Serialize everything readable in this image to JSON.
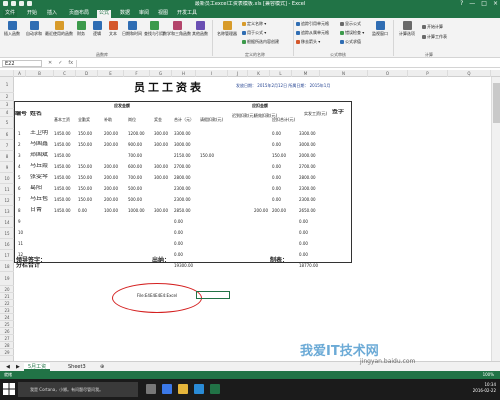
{
  "window": {
    "title": "最新员工excel工资表模板.xls [兼容模式] - Excel",
    "controls": [
      "?",
      "—",
      "□",
      "×"
    ]
  },
  "ribbon": {
    "tabs": [
      "文件",
      "开始",
      "插入",
      "页面布局",
      "公式",
      "数据",
      "审阅",
      "视图",
      "开发工具"
    ],
    "active_tab": "公式",
    "buttons": [
      {
        "label": "插入函数",
        "color": "#2f6db3"
      },
      {
        "label": "自动求和",
        "color": "#2f6db3"
      },
      {
        "label": "最近使用的函数",
        "color": "#d89b2a"
      },
      {
        "label": "财务",
        "color": "#3c9a4b"
      },
      {
        "label": "逻辑",
        "color": "#2f6db3"
      },
      {
        "label": "文本",
        "color": "#d4572b"
      },
      {
        "label": "日期和时间",
        "color": "#2f6db3"
      },
      {
        "label": "查找与引用",
        "color": "#3c9a4b"
      },
      {
        "label": "数学和三角函数",
        "color": "#b3456b"
      },
      {
        "label": "其他函数",
        "color": "#6a4fb3"
      },
      {
        "label": "名称管理器",
        "color": "#d89b2a"
      }
    ],
    "small_buttons": [
      "定义名称 ▾",
      "用于公式 ▾",
      "根据所选内容创建",
      "追踪引用单元格",
      "追踪从属单元格",
      "移去箭头 ▾",
      "显示公式",
      "错误检查 ▾",
      "公式求值",
      "监视窗口",
      "计算选项",
      "开始计算",
      "计算工作表"
    ],
    "groups": [
      "函数库",
      "定义的名称",
      "公式审核",
      "计算"
    ]
  },
  "formula_bar": {
    "name_box": "E22",
    "fx": "fx",
    "value": ""
  },
  "columns": [
    "A",
    "B",
    "C",
    "D",
    "E",
    "F",
    "G",
    "H",
    "I",
    "J",
    "K",
    "L",
    "M",
    "N",
    "O",
    "P",
    "Q"
  ],
  "rows": [
    "1",
    "2",
    "3",
    "4",
    "5",
    "6",
    "7",
    "8",
    "9",
    "10",
    "11",
    "12",
    "13",
    "14",
    "15",
    "16",
    "17",
    "18",
    "19",
    "20",
    "21",
    "22",
    "23",
    "24",
    "25",
    "26",
    "27",
    "28",
    "29"
  ],
  "sheet": {
    "title": "员工工资表",
    "date_label": "发放日期：  2015年2月12日  所属日期：  2015年1月",
    "headers": {
      "num": "编号",
      "name": "姓名",
      "payable": "应发金额",
      "deduct": "应扣金额",
      "net": "实发工资(元)",
      "sign": "签字",
      "sub": [
        "基本工资",
        "全勤奖",
        "补助",
        "岗位",
        "奖金",
        "合计（元）",
        "请假扣款(元)",
        "迟到扣款(元)",
        "绩效扣款(元)",
        "应扣合计(元)"
      ]
    },
    "rows": [
      {
        "no": "1",
        "name": "王卫明",
        "cells": [
          "1450.00",
          "150.00",
          "200.00",
          "1200.00",
          "300.00",
          "3300.00",
          "",
          "",
          "",
          "0.00",
          "3300.00"
        ]
      },
      {
        "no": "2",
        "name": "马国鑫",
        "cells": [
          "1450.00",
          "150.00",
          "200.00",
          "900.00",
          "300.00",
          "3000.00",
          "",
          "",
          "",
          "0.00",
          "3000.00"
        ]
      },
      {
        "no": "3",
        "name": "郑国斌",
        "cells": [
          "1450.00",
          "",
          "",
          "700.00",
          "",
          "2150.00",
          "150.00",
          "",
          "",
          "150.00",
          "2000.00"
        ]
      },
      {
        "no": "4",
        "name": "马丘霞",
        "cells": [
          "1450.00",
          "150.00",
          "200.00",
          "600.00",
          "300.00",
          "2700.00",
          "",
          "",
          "",
          "0.00",
          "2700.00"
        ]
      },
      {
        "no": "5",
        "name": "张雯琴",
        "cells": [
          "1450.00",
          "150.00",
          "200.00",
          "700.00",
          "300.00",
          "2800.00",
          "",
          "",
          "",
          "0.00",
          "2800.00"
        ]
      },
      {
        "no": "6",
        "name": "葛阳",
        "cells": [
          "1450.00",
          "150.00",
          "200.00",
          "500.00",
          "",
          "2300.00",
          "",
          "",
          "",
          "0.00",
          "2300.00"
        ]
      },
      {
        "no": "7",
        "name": "马丘苞",
        "cells": [
          "1450.00",
          "150.00",
          "200.00",
          "500.00",
          "",
          "2300.00",
          "",
          "",
          "",
          "0.00",
          "2300.00"
        ]
      },
      {
        "no": "8",
        "name": "甘菁",
        "cells": [
          "1450.00",
          "0.00",
          "100.00",
          "1000.00",
          "300.00",
          "2850.00",
          "",
          "",
          "200.00",
          "200.00",
          "2650.00"
        ]
      },
      {
        "no": "9",
        "name": "",
        "cells": [
          "",
          "",
          "",
          "",
          "",
          "0.00",
          "",
          "",
          "",
          "",
          "0.00"
        ]
      },
      {
        "no": "10",
        "name": "",
        "cells": [
          "",
          "",
          "",
          "",
          "",
          "0.00",
          "",
          "",
          "",
          "",
          "0.00"
        ]
      },
      {
        "no": "11",
        "name": "",
        "cells": [
          "",
          "",
          "",
          "",
          "",
          "0.00",
          "",
          "",
          "",
          "",
          "0.00"
        ]
      },
      {
        "no": "12",
        "name": "",
        "cells": [
          "",
          "",
          "",
          "",
          "",
          "0.00",
          "",
          "",
          "",
          "",
          "0.00"
        ]
      }
    ],
    "total_label": "分栏合计",
    "total_value": "19300.00",
    "total_net": "18770.00",
    "signatures": {
      "leader": "领导签字：",
      "cashier": "出纳：",
      "preparer": "制表："
    },
    "oval_text": "File:E4E4E4E4:Excel"
  },
  "sheet_tabs": [
    "5月工资",
    "Sheet3"
  ],
  "status": {
    "ready": "就绪",
    "zoom": "100%"
  },
  "taskbar": {
    "search": "我是 Cortana，小娜。有问题尽管问我。",
    "time": "10:34",
    "date": "2016-02-22"
  },
  "watermark": {
    "main": "我爱IT技术网",
    "sub": "jingyan.baidu.com"
  }
}
